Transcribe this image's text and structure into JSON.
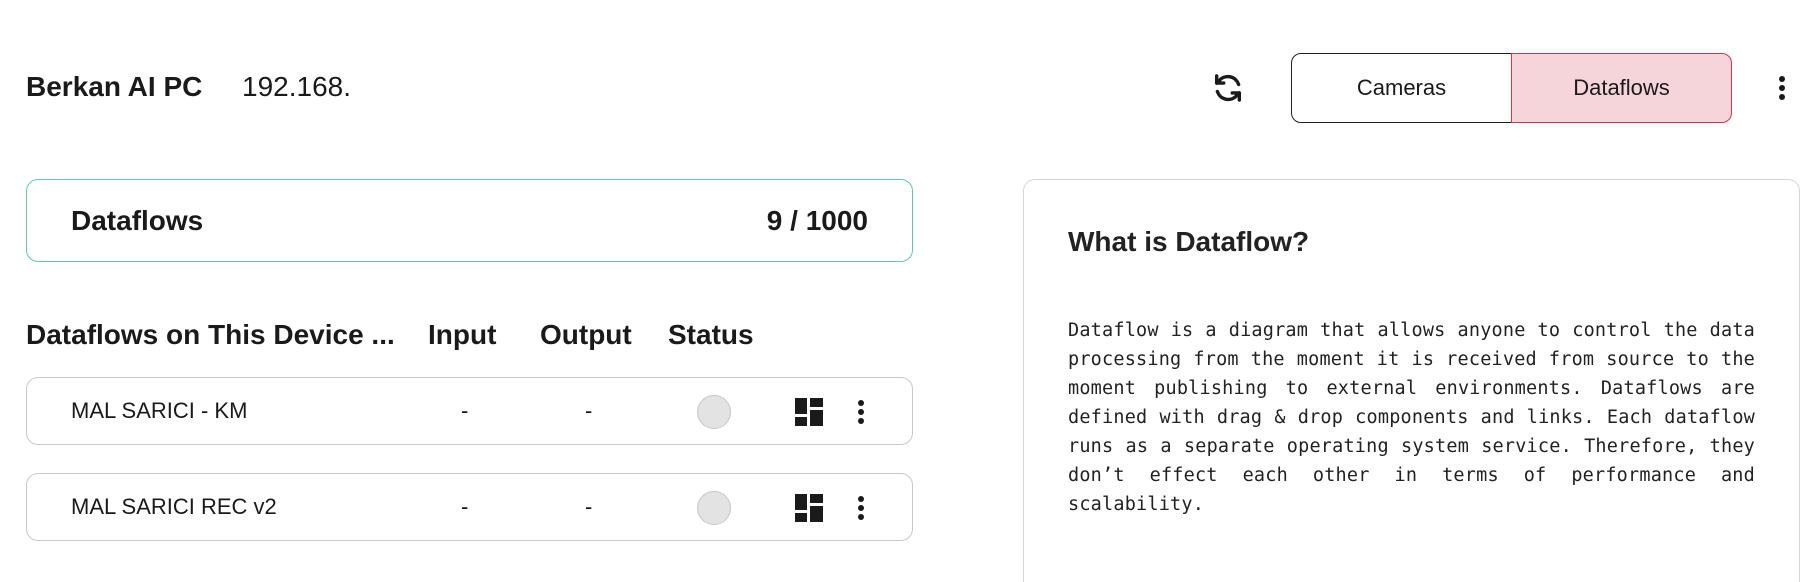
{
  "header": {
    "device_name": "Berkan AI PC",
    "device_ip": "192.168.",
    "refresh_icon": "refresh-icon",
    "tabs": [
      {
        "label": "Cameras",
        "active": false
      },
      {
        "label": "Dataflows",
        "active": true
      }
    ],
    "more_icon": "kebab-menu-icon"
  },
  "summary": {
    "title": "Dataflows",
    "count": "9 / 1000",
    "border_color": "#62c9a6"
  },
  "table": {
    "headers": {
      "name": "Dataflows on This Device ...",
      "input": "Input",
      "output": "Output",
      "status": "Status"
    },
    "rows": [
      {
        "name": "MAL SARICI - KM",
        "input": "-",
        "output": "-",
        "status": "inactive"
      },
      {
        "name": "MAL SARICI REC v2",
        "input": "-",
        "output": "-",
        "status": "inactive"
      }
    ]
  },
  "info": {
    "title": "What is Dataflow?",
    "body": "Dataflow is a diagram that allows anyone to control the data processing from the moment it is received from source to the moment publishing to external environments. Dataflows are defined with drag & drop components and links. Each dataflow runs as a separate operating system service. Therefore, they don’t effect each other in terms of performance and scalability."
  },
  "colors": {
    "active_tab_bg": "#f5d4da",
    "active_tab_border": "#c93a4e",
    "status_inactive": "#e3e3e3"
  }
}
